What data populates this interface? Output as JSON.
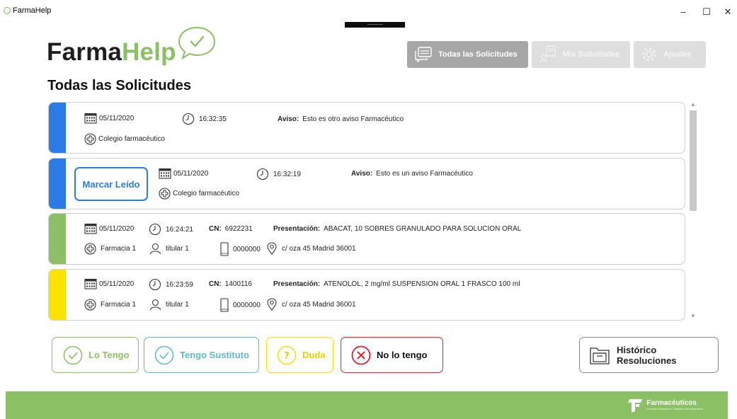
{
  "window": {
    "title": "FarmaHelp",
    "minimize": "–",
    "maximize": "☐",
    "close": "✕"
  },
  "logo": {
    "part1": "Farma",
    "part2": "Help"
  },
  "page_title": "Todas las Solicitudes",
  "nav": [
    {
      "label": "Todas las Solicitudes",
      "icon": "chat-bubbles-icon",
      "active": true
    },
    {
      "label": "Mis Solicitudes",
      "icon": "user-list-icon",
      "active": false
    },
    {
      "label": "Ajustes",
      "icon": "gear-icon",
      "active": false
    }
  ],
  "cards": [
    {
      "color": "#2b7be6",
      "date": "05/11/2020",
      "time": "16:32:35",
      "aviso_label": "Aviso:",
      "aviso": "Esto es otro aviso Farmacéutico",
      "sender": "Colegio farmacéutico"
    },
    {
      "color": "#2b7be6",
      "button": "Marcar Leído",
      "date": "05/11/2020",
      "time": "16:32:19",
      "aviso_label": "Aviso:",
      "aviso": "Esto es un aviso Farmacéutico",
      "sender": "Colegio farmacéutico"
    },
    {
      "color": "#8bc064",
      "date": "05/11/2020",
      "time": "16:24:21",
      "cn_label": "CN:",
      "cn": "6922231",
      "pres_label": "Presentación:",
      "pres": "ABACAT, 10 SOBRES GRANULADO PARA SOLUCION ORAL",
      "pharmacy": "Farmacia 1",
      "user": "titular 1",
      "phone": "0000000",
      "address": "c/ oza 45 Madrid 36001"
    },
    {
      "color": "#fce200",
      "date": "05/11/2020",
      "time": "16:23:59",
      "cn_label": "CN:",
      "cn": "1400116",
      "pres_label": "Presentación:",
      "pres": "ATENOLOL, 2 mg/ml SUSPENSION ORAL 1 FRASCO 100 ml",
      "pharmacy": "Farmacia 1",
      "user": "titular 1",
      "phone": "0000000",
      "address": "c/ oza 45 Madrid 36001"
    }
  ],
  "actions": {
    "lo_tengo": "Lo Tengo",
    "sustituto": "Tengo Sustituto",
    "duda": "Duda",
    "no_tengo": "No lo tengo",
    "historico": "Histórico Resoluciones"
  },
  "colors": {
    "green": "#8bc064",
    "teal": "#5bbcc9",
    "yellow": "#fce200",
    "red": "#e0202c",
    "blue": "#2b7be6"
  },
  "footer": {
    "brand": "Farmacéuticos",
    "sub": "Consejo General de Colegios Farmacéuticos"
  }
}
